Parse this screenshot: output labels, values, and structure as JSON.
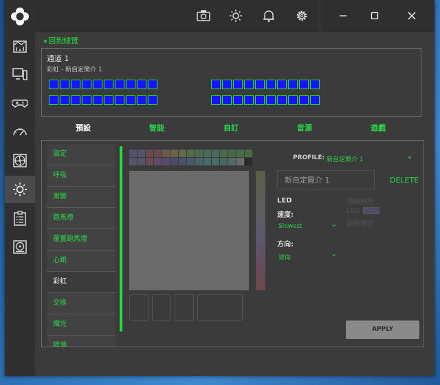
{
  "back_label": "回到總覽",
  "device": {
    "title": "通道 1",
    "subtitle": "彩虹 - 新自定簡介 1",
    "led_color": "#1414ff",
    "led_border": "#22e03a"
  },
  "tabs": [
    {
      "label": "預設",
      "active": true
    },
    {
      "label": "智能",
      "active": false
    },
    {
      "label": "自訂",
      "active": false
    },
    {
      "label": "音源",
      "active": false
    },
    {
      "label": "遊戲",
      "active": false
    }
  ],
  "effects": [
    {
      "label": "固定"
    },
    {
      "label": "呼吸"
    },
    {
      "label": "漸變"
    },
    {
      "label": "跑馬燈"
    },
    {
      "label": "覆蓋跑馬燈"
    },
    {
      "label": "心跳"
    },
    {
      "label": "彩虹",
      "active": true
    },
    {
      "label": "交換"
    },
    {
      "label": "燭光"
    },
    {
      "label": "錯落"
    }
  ],
  "profile": {
    "label": "PROFILE:",
    "value": "新自定簡介 1",
    "name_input": "新自定簡介 1",
    "delete_label": "DELETE"
  },
  "led_section": {
    "title": "LED",
    "speed_label": "速度:",
    "speed_value": "Slowest",
    "direction_label": "方向:",
    "direction_value": "逆向",
    "faint_1": "隨機顏色",
    "faint_2": "LED",
    "faint_3": "最新顏色"
  },
  "apply_label": "APPLY",
  "accent_color": "#2ad84a"
}
